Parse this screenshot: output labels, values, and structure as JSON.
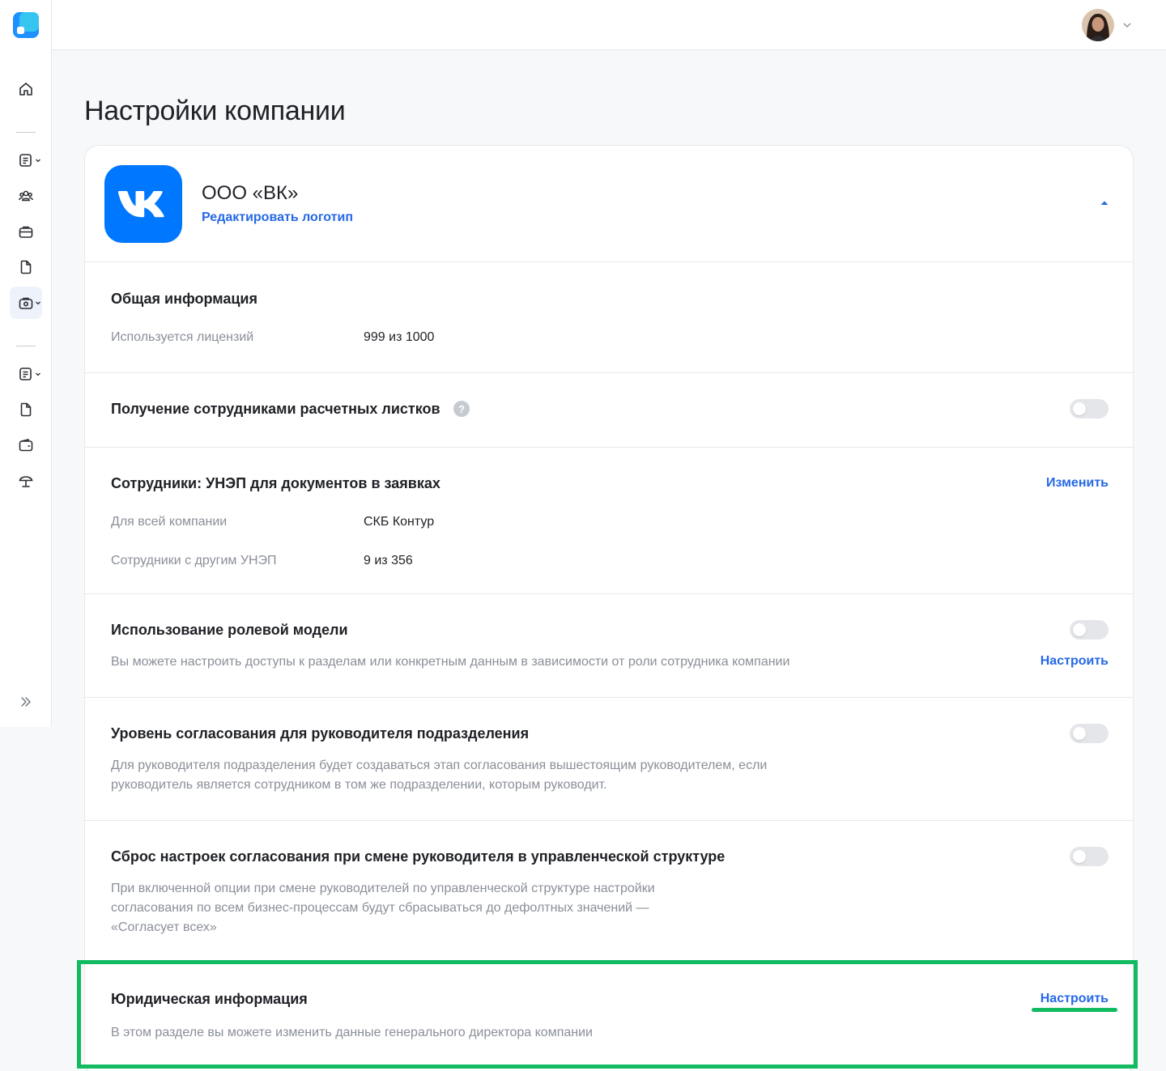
{
  "colors": {
    "accent": "#2568e6",
    "brand_vk": "#0077ff",
    "highlight": "#12bb61",
    "muted_text": "#8a8f98"
  },
  "sidebar": {
    "logo_icon": "app-logo-icon",
    "items": [
      {
        "name": "home",
        "icon": "home-icon"
      },
      {
        "name": "documents",
        "icon": "document-list-icon",
        "has_dropdown": true
      },
      {
        "name": "people",
        "icon": "users-icon"
      },
      {
        "name": "jobs",
        "icon": "briefcase-icon"
      },
      {
        "name": "files",
        "icon": "file-icon"
      },
      {
        "name": "company-settings",
        "icon": "company-settings-icon",
        "has_dropdown": true,
        "active": true
      },
      {
        "name": "requests",
        "icon": "document-list-icon",
        "has_dropdown": true
      },
      {
        "name": "files-2",
        "icon": "file-icon"
      },
      {
        "name": "wallet",
        "icon": "wallet-icon"
      },
      {
        "name": "vacation",
        "icon": "umbrella-icon"
      }
    ],
    "expand_icon": "double-chevron-right-icon"
  },
  "topbar": {
    "avatar_icon": "user-avatar",
    "menu_icon": "chevron-down-icon"
  },
  "page": {
    "title": "Настройки компании"
  },
  "company": {
    "name": "ООО «ВК»",
    "edit_logo_label": "Редактировать логотип",
    "logo_letters": "VK"
  },
  "general": {
    "title": "Общая информация",
    "licenses_label": "Используется лицензий",
    "licenses_value": "999 из 1000"
  },
  "payslips": {
    "title": "Получение сотрудниками расчетных листков",
    "help": "?",
    "toggle_on": false
  },
  "signature": {
    "title": "Сотрудники: УНЭП для документов в заявках",
    "action_label": "Изменить",
    "company_label": "Для всей компании",
    "company_value": "СКБ Контур",
    "other_label": "Сотрудники с другим УНЭП",
    "other_value": "9 из 356"
  },
  "roles": {
    "title": "Использование ролевой модели",
    "description": "Вы можете настроить доступы к разделам или конкретным данным в зависимости от роли сотрудника компании",
    "action_label": "Настроить",
    "toggle_on": false
  },
  "approval_level": {
    "title": "Уровень согласования для руководителя подразделения",
    "description_line1": "Для руководителя подразделения будет создаваться этап согласования вышестоящим руководителем, если",
    "description_line2": "руководитель является сотрудником в том же подразделении, которым руководит.",
    "toggle_on": false
  },
  "approval_reset": {
    "title": "Сброс настроек согласования при смене руководителя в управленческой структуре",
    "description_line1": "При включенной опции при смене руководителей по управленческой структуре настройки",
    "description_line2": "согласования по всем бизнес-процессам будут сбрасываться до дефолтных значений —",
    "description_line3": "«Согласует всех»",
    "toggle_on": false
  },
  "legal": {
    "title": "Юридическая информация",
    "description": "В этом разделе вы можете изменить данные генерального директора компании",
    "action_label": "Настроить"
  }
}
